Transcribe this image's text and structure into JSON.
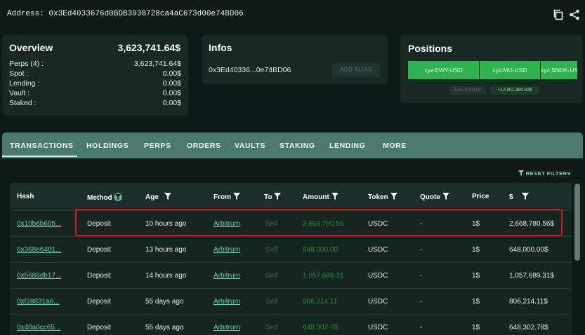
{
  "header": {
    "address_label": "Address:",
    "address": "0x3Ed4033676d0BDB3938728ca4aC673d00e74BD06",
    "copy_icon": "copy-icon",
    "share_icon": "share-icon"
  },
  "overview": {
    "title": "Overview",
    "total": "3,623,741.64$",
    "rows": [
      {
        "label": "Perps (4) :",
        "value": "3,623,741.64$"
      },
      {
        "label": "Spot :",
        "value": "0.00$"
      },
      {
        "label": "Lending :",
        "value": "0.00$"
      },
      {
        "label": "Vault :",
        "value": "0.00$"
      },
      {
        "label": "Staked :",
        "value": "0.00$"
      }
    ]
  },
  "infos": {
    "title": "Infos",
    "address_short": "0x3Ed40336...0e74BD06",
    "add_alias": "ADD ALIAS"
  },
  "positions": {
    "title": "Positions",
    "chips": [
      "xyz:EWY-USD",
      "xyz:MU-USD",
      "xyz:SNDK-US"
    ],
    "lev": "Lev. 3.3119x",
    "pnl": "+12,901,380.62$"
  },
  "tabs": [
    "TRANSACTIONS",
    "HOLDINGS",
    "PERPS",
    "ORDERS",
    "VAULTS",
    "STAKING",
    "LENDING",
    "MORE"
  ],
  "reset_filters": "RESET FILTERS",
  "table": {
    "headers": [
      "Hash",
      "Method",
      "Age",
      "From",
      "To",
      "Amount",
      "Token",
      "Quote",
      "Price",
      "$"
    ],
    "rows": [
      {
        "hash": "0x10b6b605...",
        "method": "Deposit",
        "age": "10 hours ago",
        "from": "Arbitrum",
        "to": "Self",
        "amount": "2,668,780.56",
        "token": "USDC",
        "quote": "-",
        "price": "1$",
        "usd": "2,668,780.56$"
      },
      {
        "hash": "0x368e6401...",
        "method": "Deposit",
        "age": "13 hours ago",
        "from": "Arbitrum",
        "to": "Self",
        "amount": "648,000.00",
        "token": "USDC",
        "quote": "-",
        "price": "1$",
        "usd": "648,000.00$"
      },
      {
        "hash": "0x5686db17...",
        "method": "Deposit",
        "age": "14 hours ago",
        "from": "Arbitrum",
        "to": "Self",
        "amount": "1,057,689.31",
        "token": "USDC",
        "quote": "-",
        "price": "1$",
        "usd": "1,057,689.31$"
      },
      {
        "hash": "0xf28831a6...",
        "method": "Deposit",
        "age": "55 days ago",
        "from": "Arbitrum",
        "to": "Self",
        "amount": "806,214.11",
        "token": "USDC",
        "quote": "-",
        "price": "1$",
        "usd": "806,214.11$"
      },
      {
        "hash": "0x40a0cc65...",
        "method": "Deposit",
        "age": "55 days ago",
        "from": "Arbitrum",
        "to": "Self",
        "amount": "648,302.78",
        "token": "USDC",
        "quote": "-",
        "price": "1$",
        "usd": "648,302.78$"
      }
    ]
  },
  "colors": {
    "background": "#0c1b17",
    "card": "#182823",
    "tab_bar": "#4a7a6f",
    "accent_link": "#5fd3b1",
    "positive": "#2fb451",
    "highlight": "#e0101d"
  }
}
